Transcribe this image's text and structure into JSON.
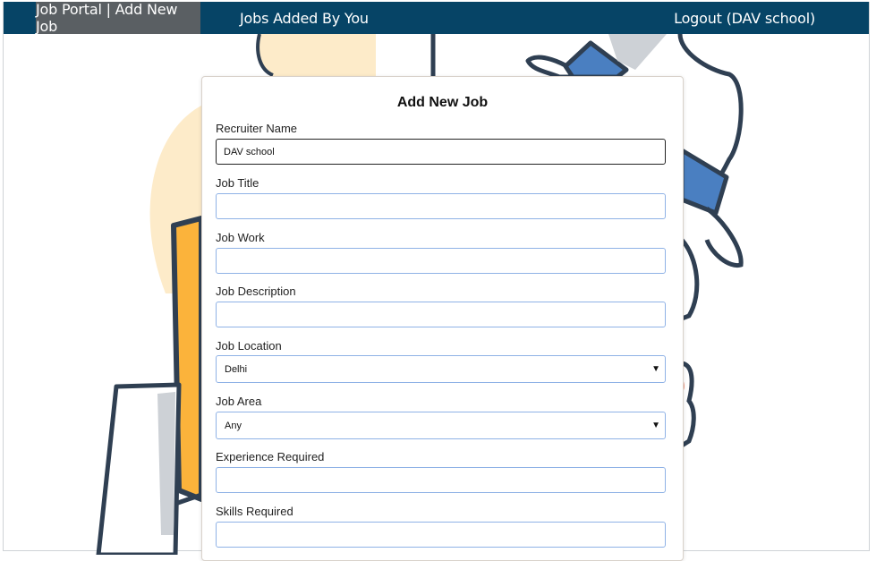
{
  "navbar": {
    "brand": "Job Portal | Add New Job",
    "jobs_link": "Jobs Added By You",
    "logout": "Logout (DAV school)"
  },
  "form": {
    "title": "Add New Job",
    "recruiter_name": {
      "label": "Recruiter Name",
      "value": "DAV school"
    },
    "job_title": {
      "label": "Job Title",
      "value": ""
    },
    "job_work": {
      "label": "Job Work",
      "value": ""
    },
    "job_description": {
      "label": "Job Description",
      "value": ""
    },
    "job_location": {
      "label": "Job Location",
      "selected": "Delhi"
    },
    "job_area": {
      "label": "Job Area",
      "selected": "Any"
    },
    "experience": {
      "label": "Experience Required",
      "value": ""
    },
    "skills": {
      "label": "Skills Required",
      "value": ""
    }
  },
  "colors": {
    "navbar": "#064466",
    "brand_bg": "#5a5f63",
    "input_border": "#8fb2e6",
    "illustration_blue": "#4a7fc1",
    "illustration_orange": "#fbb33b",
    "illustration_cream": "#fdebc9",
    "illustration_outline": "#2f3f52"
  }
}
